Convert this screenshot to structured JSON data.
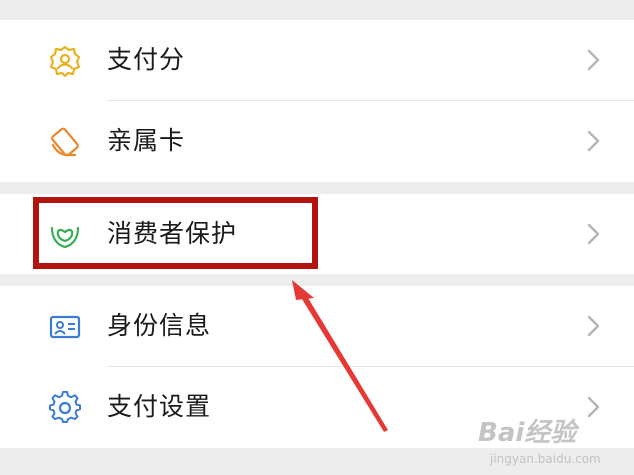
{
  "menu": {
    "items": [
      {
        "label": "支付分",
        "icon": "payment-score-icon",
        "color": "#e8b321"
      },
      {
        "label": "亲属卡",
        "icon": "family-card-icon",
        "color": "#e8892e"
      },
      {
        "label": "消费者保护",
        "icon": "consumer-protection-icon",
        "color": "#3aae55"
      },
      {
        "label": "身份信息",
        "icon": "id-card-icon",
        "color": "#3a7bd5"
      },
      {
        "label": "支付设置",
        "icon": "settings-gear-icon",
        "color": "#3a7bd5"
      }
    ],
    "chevron_icon": "chevron-right-icon"
  },
  "annotation": {
    "highlight_color": "#b3130f",
    "arrow_color": "#e53935",
    "highlighted_item": "消费者保护"
  },
  "watermark": {
    "logo": "Bai经验",
    "url": "jingyan.baidu.com"
  }
}
